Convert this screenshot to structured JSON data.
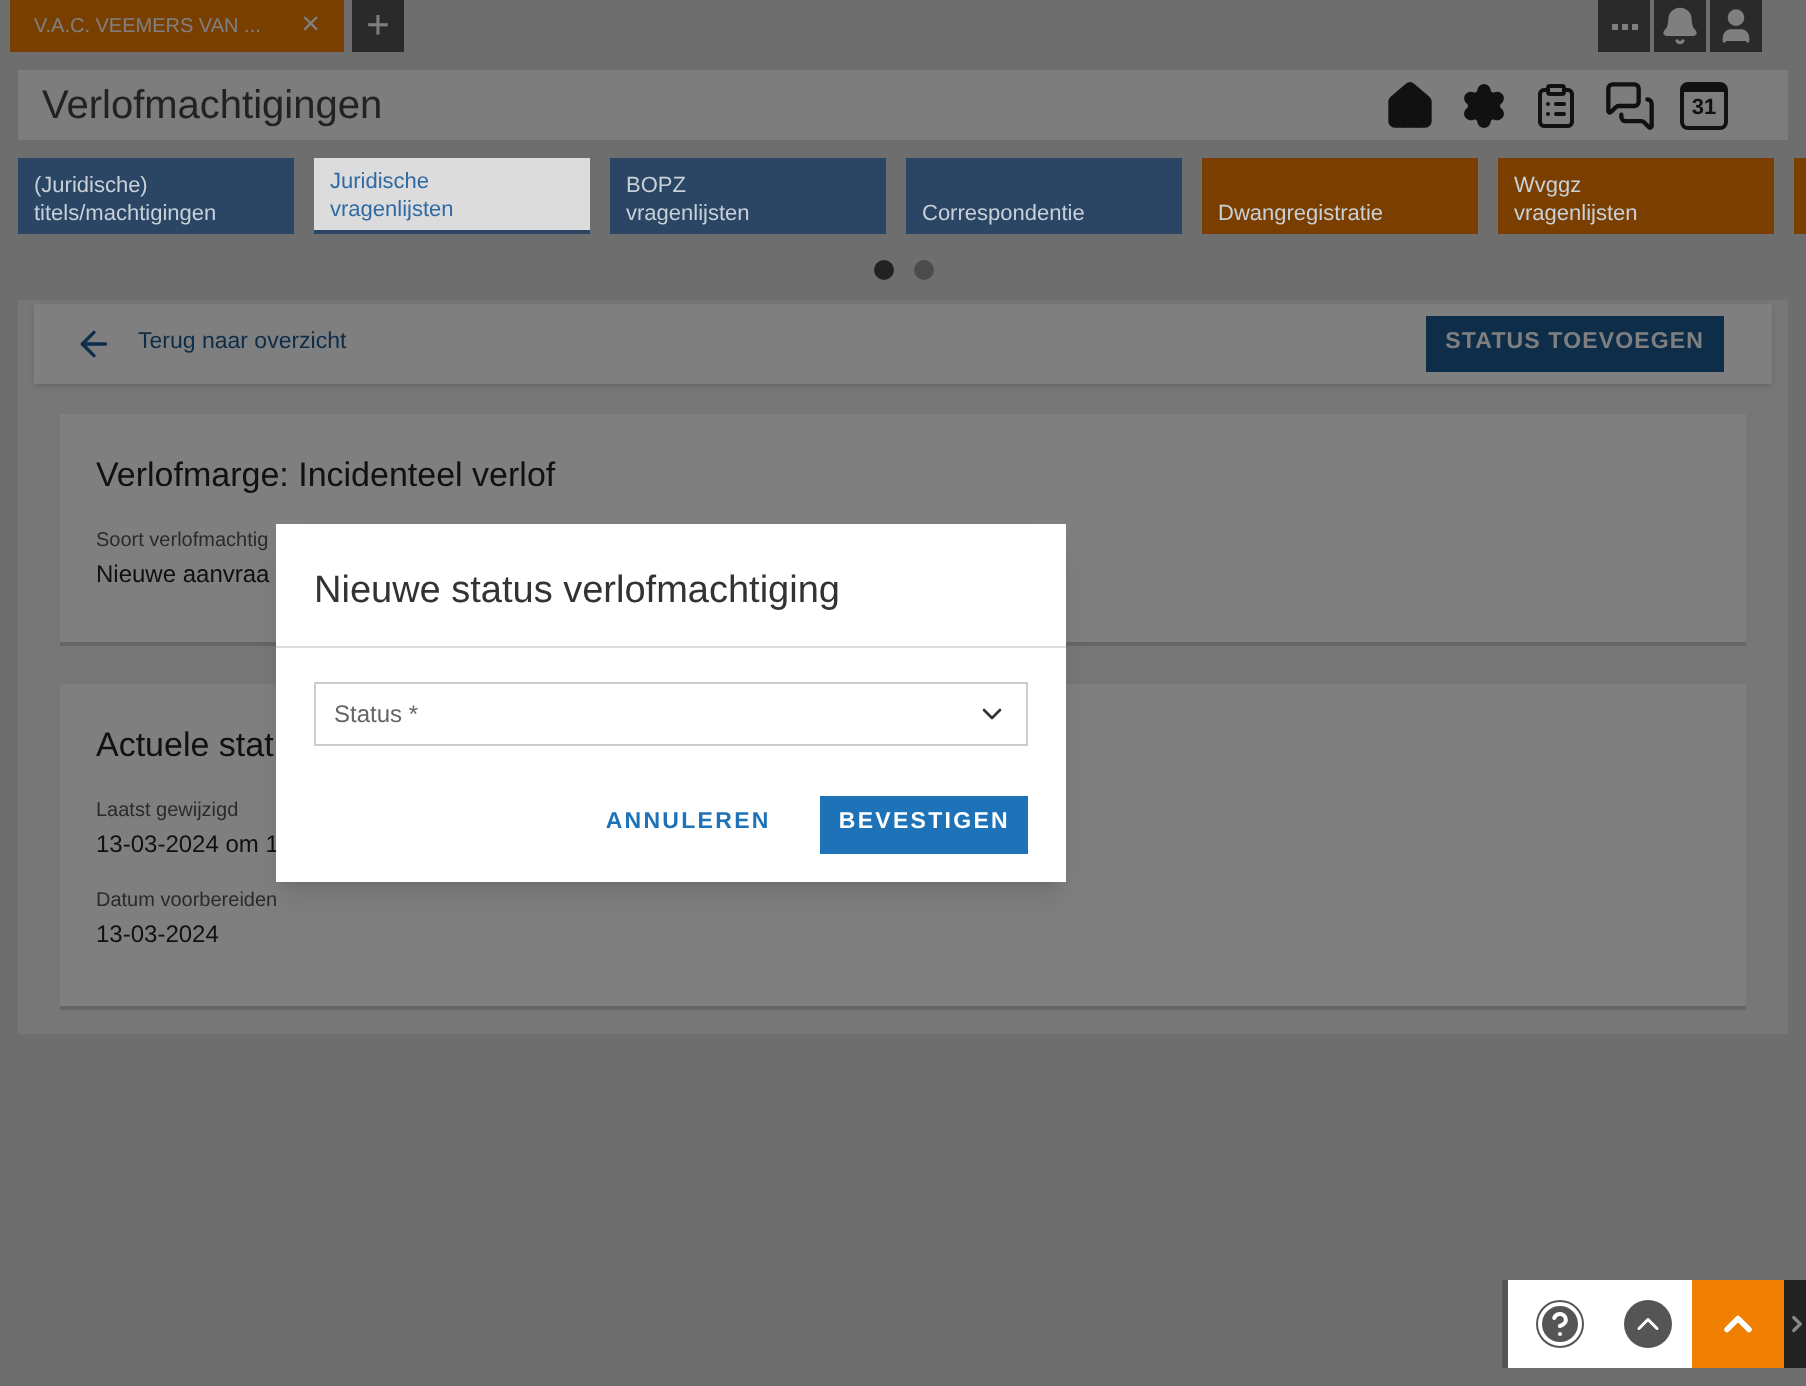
{
  "tabs": [
    {
      "label": "V.A.C. VEEMERS VAN ...",
      "close": "×",
      "selected": true
    }
  ],
  "add_tab": "+",
  "header": {
    "title": "Verlofmachtigingen",
    "calendar_day": "31"
  },
  "tiles": [
    {
      "label": "(Juridische) titels/machtigingen",
      "color": "#2a4664",
      "selected": false
    },
    {
      "label": "Juridische vragenlijsten",
      "color": "#2a4664",
      "selected": true
    },
    {
      "label": "BOPZ vragenlijsten",
      "color": "#2a4664",
      "selected": false
    },
    {
      "label": "Correspondentie",
      "color": "#2a4664",
      "selected": false
    },
    {
      "label": "Dwangregistratie",
      "color": "#7a3f00",
      "selected": false
    },
    {
      "label": "Wvggz vragenlijsten",
      "color": "#7a3f00",
      "selected": false
    }
  ],
  "pager": [
    {
      "selected": true
    },
    {
      "selected": false
    }
  ],
  "toolbar": {
    "back": "Terug naar overzicht",
    "action": "STATUS TOEVOEGEN"
  },
  "cards": [
    {
      "title": "Verlofmarge: Incidenteel verlof",
      "fields": [
        {
          "label": "Soort verlofmachtig",
          "value": "Nieuwe aanvraa"
        }
      ]
    },
    {
      "title": "Actuele stat",
      "fields": [
        {
          "label": "Laatst gewijzigd",
          "value": "13-03-2024 om 1"
        },
        {
          "label": "Datum voorbereiden",
          "value": "13-03-2024"
        }
      ]
    }
  ],
  "dialog": {
    "title": "Nieuwe status verlofmachtiging",
    "select": {
      "placeholder": "Status *"
    },
    "buttons": [
      {
        "label": "ANNULEREN",
        "kind": "text"
      },
      {
        "label": "BEVESTIGEN",
        "kind": "primary"
      }
    ]
  }
}
